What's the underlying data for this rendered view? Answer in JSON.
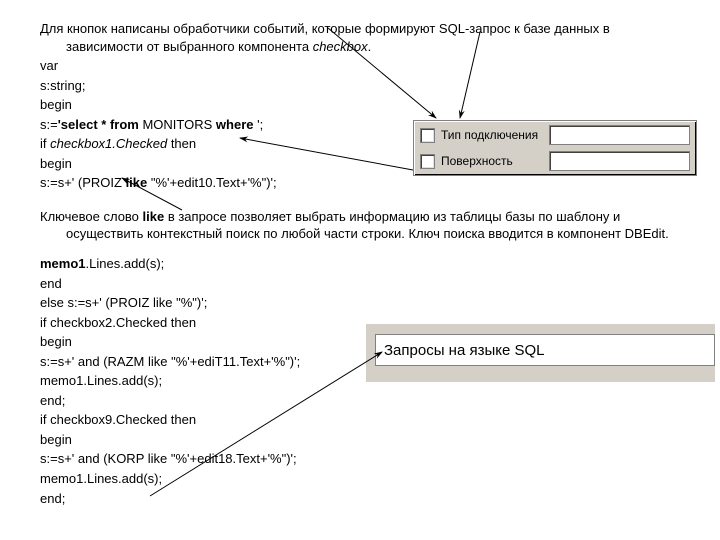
{
  "intro": "Для кнопок написаны обработчики событий, которые формируют SQL-запрос к базе данных в зависимости от выбранного компонента ",
  "intro_italic": "checkbox",
  "intro_tail": ".",
  "code1": {
    "l1": "var",
    "l2": "s:string;",
    "l3": "begin",
    "l4_a": "s:=",
    "l4_b": "'select * from ",
    "l4_c": "MONITORS",
    "l4_d": " where ",
    "l4_e": "';",
    "l5_a": "if ",
    "l5_b": "checkbox1.Checked",
    "l5_c": " then",
    "l6": "begin",
    "l7_a": "s:=s+' (PROIZ ",
    "l7_b": "like ",
    "l7_c": "\"%'+edit10.Text+'%\")';"
  },
  "mid_a": "Ключевое слово ",
  "mid_b": "like",
  "mid_c": " в запросе позволяет выбрать информацию из таблицы базы по шаблону и осуществить контекстный поиск по любой части строки. Ключ поиска вводится в компонент DBEdit.",
  "code2": {
    "l1_a": "memo1",
    "l1_b": ".Lines.add(s);",
    "l2": "end",
    "l3": "else s:=s+' (PROIZ like \"%\")';",
    "l4": "if checkbox2.Checked then",
    "l5": "begin",
    "l6": "s:=s+' and (RAZM like \"%'+ediT11.Text+'%\")';",
    "l7": "memo1.Lines.add(s);",
    "l8": "end;",
    "l9": "if checkbox9.Checked then",
    "l10": "begin",
    "l11": "s:=s+' and (KORP like \"%'+edit18.Text+'%\")';",
    "l12": "memo1.Lines.add(s);",
    "l13": "end;"
  },
  "panel1": {
    "row1": "Тип подключения",
    "row2": "Поверхность"
  },
  "panel2": {
    "title": "Запросы на языке SQL"
  }
}
